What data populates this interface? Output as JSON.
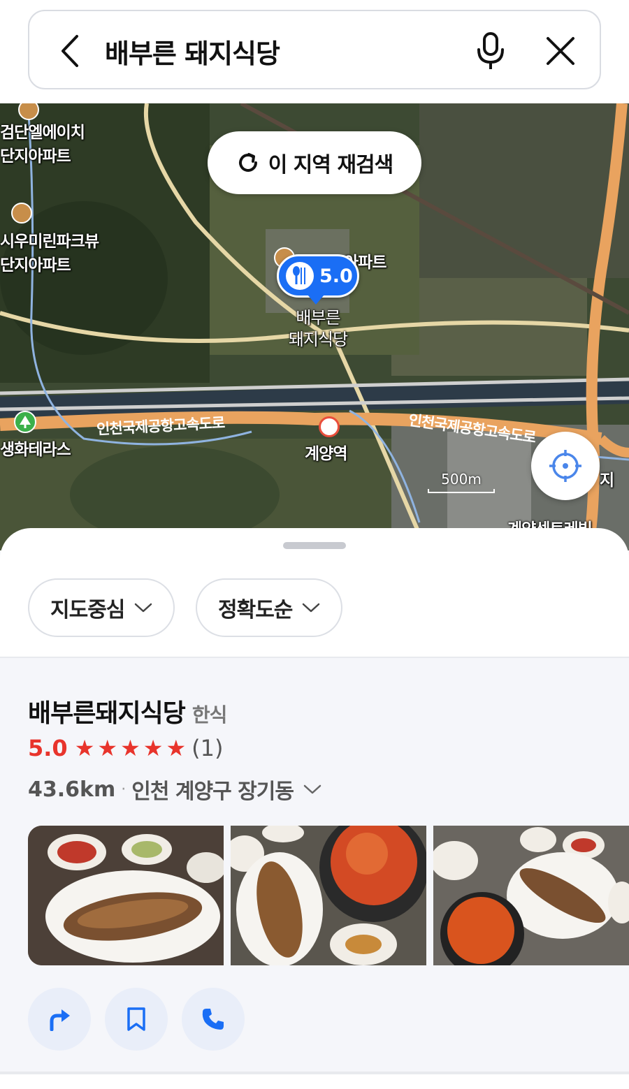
{
  "search": {
    "query": "배부른 돼지식당"
  },
  "map": {
    "research_label": "이 지역 재검색",
    "labels": {
      "apt1_line1": "검단엘에이치",
      "apt1_line2": "단지아파트",
      "apt2_line1": "시우미린파크뷰",
      "apt2_line2": "단지아파트",
      "apt3": "아파트",
      "park": "생화테라스",
      "station": "계양역",
      "highway_left": "인천국제공항고속도로",
      "highway_right": "인천국제공항고속도로",
      "bottom_right": "계양센트레빌",
      "edge_right": "지"
    },
    "pin": {
      "rating": "5.0",
      "name_line1": "배부른",
      "name_line2": "돼지식당"
    },
    "scale": "500m"
  },
  "filters": [
    {
      "label": "지도중심"
    },
    {
      "label": "정확도순"
    }
  ],
  "result": {
    "name": "배부른돼지식당",
    "category": "한식",
    "rating": "5.0",
    "rating_stars": 5,
    "review_count": "(1)",
    "distance": "43.6km",
    "separator": "·",
    "address": "인천 계양구 장기동"
  },
  "colors": {
    "accent_blue": "#1a6ef5",
    "rating_red": "#e8342c"
  },
  "icons": {
    "back": "chevron-left-icon",
    "mic": "mic-icon",
    "close": "close-icon",
    "refresh": "refresh-icon",
    "locate": "crosshair-icon",
    "directions": "directions-arrow-icon",
    "save": "bookmark-icon",
    "call": "phone-icon"
  }
}
